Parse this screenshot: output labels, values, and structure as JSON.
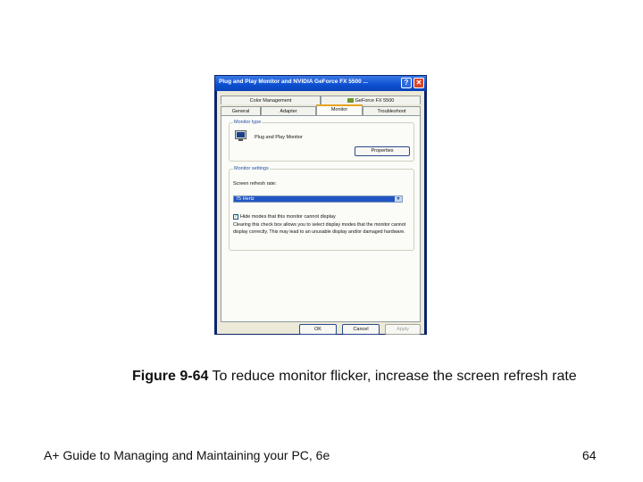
{
  "dialog": {
    "title": "Plug and Play Monitor and NVIDIA GeForce FX 5500 ...",
    "help_button": "?",
    "close_button": "✕",
    "tabs_row1": [
      "Color Management",
      "GeForce FX 5500"
    ],
    "tabs_row2": [
      "General",
      "Adapter",
      "Monitor",
      "Troubleshoot"
    ],
    "selected_tab": "Monitor",
    "monitor_type": {
      "label": "Monitor type",
      "name": "Plug and Play Monitor",
      "properties_button": "Properties"
    },
    "monitor_settings": {
      "label": "Monitor settings",
      "refresh_label": "Screen refresh rate:",
      "refresh_value": "75 Hertz",
      "hide_modes_checkbox": "Hide modes that this monitor cannot display",
      "hide_modes_checked": true,
      "description": "Clearing this check box allows you to select display modes that the monitor cannot display correctly. This may lead to an unusable display and/or damaged hardware."
    },
    "buttons": {
      "ok": "OK",
      "cancel": "Cancel",
      "apply": "Apply"
    }
  },
  "caption": {
    "figure_label": "Figure 9-64",
    "text": " To reduce monitor flicker, increase the screen refresh rate"
  },
  "footer": {
    "book_title": "A+ Guide to Managing and Maintaining your PC, 6e",
    "page_number": "64"
  },
  "colors": {
    "titlebar": "#0c4fd0",
    "selected_tab_accent": "#e7a521",
    "dropdown_selection": "#2255c4",
    "dialog_background": "#ece9d8"
  }
}
